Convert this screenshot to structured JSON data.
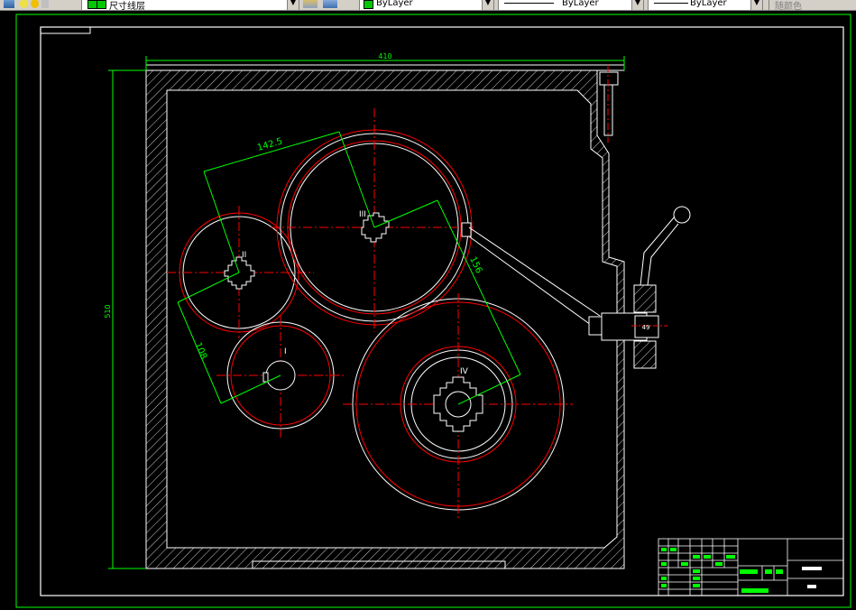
{
  "toolbar": {
    "layer_name": "尺寸线层",
    "color_value": "ByLayer",
    "linetype_value": "ByLayer",
    "lineweight_value": "ByLayer",
    "plotstyle_value": "随颜色",
    "layer_color": "#00c800"
  },
  "drawing": {
    "dim_width": "410",
    "dim_height": "510",
    "dim_center_2_3": "142.5",
    "dim_center_1_2": "108",
    "dim_center_3_4": "156",
    "label_gear_1": "I",
    "label_gear_2": "II",
    "label_gear_3": "III",
    "label_gear_4": "IV",
    "shaft_dim": "49"
  },
  "colors": {
    "background": "#000000",
    "outline": "#ffffff",
    "centerline": "#ff0000",
    "dimension": "#00ff00"
  }
}
